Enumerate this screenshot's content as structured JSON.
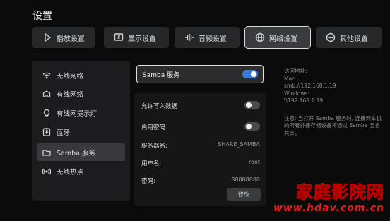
{
  "page_title": "设置",
  "tabs": [
    {
      "label": "播放设置",
      "icon": "play-icon"
    },
    {
      "label": "显示设置",
      "icon": "display-icon"
    },
    {
      "label": "音频设置",
      "icon": "audio-icon"
    },
    {
      "label": "网络设置",
      "icon": "globe-icon",
      "active": true
    },
    {
      "label": "其他设置",
      "icon": "more-icon"
    }
  ],
  "sidebar": {
    "items": [
      {
        "label": "无线网络",
        "icon": "wifi-icon"
      },
      {
        "label": "有线网络",
        "icon": "ethernet-icon"
      },
      {
        "label": "有线网提示灯",
        "icon": "bulb-icon"
      },
      {
        "label": "蓝牙",
        "icon": "bluetooth-icon"
      },
      {
        "label": "Samba 服务",
        "icon": "folder-icon",
        "active": true
      },
      {
        "label": "无线热点",
        "icon": "hotspot-icon"
      }
    ]
  },
  "samba": {
    "label": "Samba 服务",
    "enabled": true
  },
  "settings": {
    "allow_write": {
      "label": "允许写入数据",
      "enabled": false
    },
    "enable_password": {
      "label": "启用密码",
      "enabled": false
    },
    "server_name": {
      "label": "服务器名:",
      "value": "SHARE_SAMBA"
    },
    "username": {
      "label": "用户名:",
      "value": "root"
    },
    "password": {
      "label": "密码:",
      "value": "88888888"
    },
    "edit_label": "修改"
  },
  "info": {
    "heading": "访问地址:",
    "mac_label": "Mac:",
    "mac_addr": "smb://192.168.1.19",
    "win_label": "Windows:",
    "win_addr": "\\\\192.168.1.19",
    "note": "注意: 当打开 Samba 服务时, 连接到本机的所有外接存储设备将通过 Samba 匿名共享。"
  },
  "watermark": {
    "title": "家庭影院网",
    "url": "www.hdav.com.cn"
  },
  "colors": {
    "accent": "#3a7bd5",
    "watermark_red": "#e02020"
  }
}
